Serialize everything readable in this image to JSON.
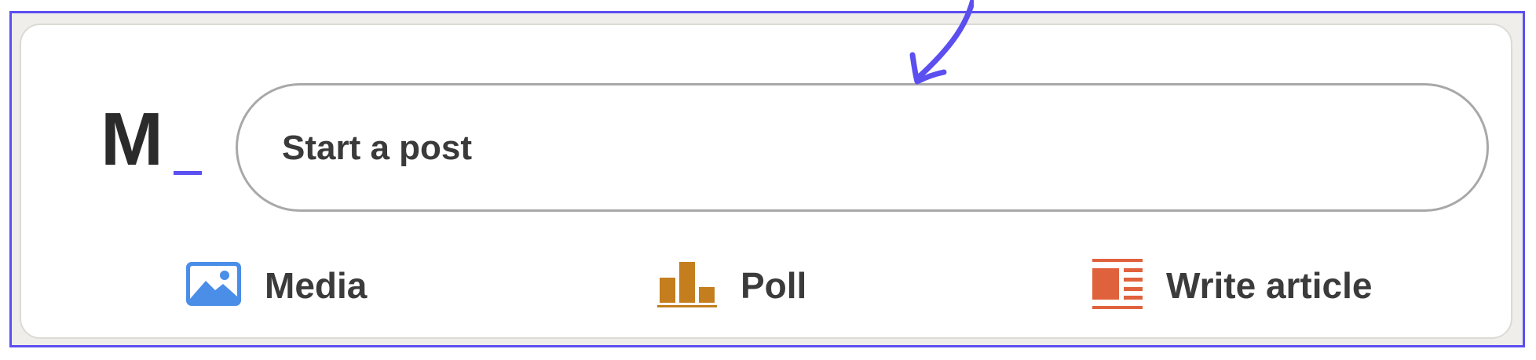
{
  "brand": {
    "logo_letter": "M",
    "accent_color": "#5b4ff0"
  },
  "composer": {
    "placeholder_text": "Start a post"
  },
  "actions": [
    {
      "label": "Media",
      "icon": "image-icon",
      "color": "#4a8ee8"
    },
    {
      "label": "Poll",
      "icon": "bar-chart-icon",
      "color": "#c47e1e"
    },
    {
      "label": "Write article",
      "icon": "article-icon",
      "color": "#e0623d"
    }
  ],
  "annotation": {
    "icon": "hand-drawn-arrow-icon",
    "color": "#5b4ff0"
  }
}
